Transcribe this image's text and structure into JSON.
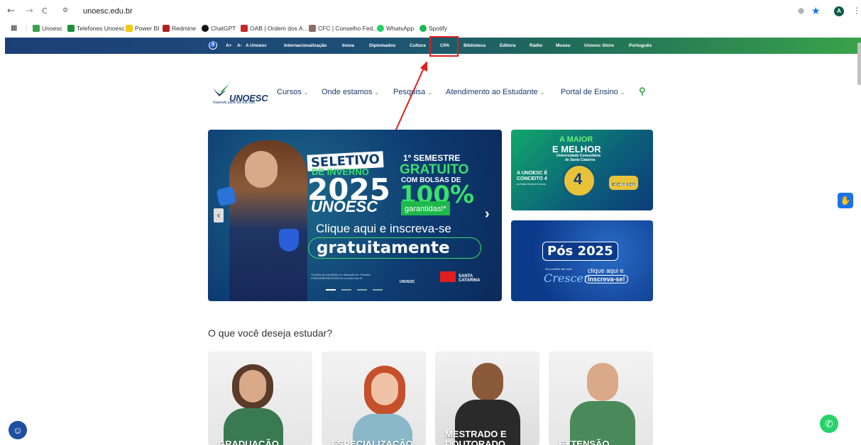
{
  "browser": {
    "url": "unoesc.edu.br",
    "back": "←",
    "forward": "→",
    "reload": "C",
    "avatar": "A",
    "bookmarks": [
      "Unoesc",
      "Telefones Unoesc",
      "Power BI",
      "Redmine",
      "ChatGPT",
      "OAB | Ordem dos A...",
      "CFC | Conselho Fed...",
      "WhatsApp",
      "Spotify"
    ]
  },
  "topbar": {
    "items": [
      "A+",
      "A-",
      "A Unoesc",
      "Internacionalização",
      "Inova",
      "Diplomados",
      "Cultura",
      "CPA",
      "Biblioteca",
      "Editora",
      "Rádio",
      "Museu",
      "Unoesc Store",
      "Português"
    ]
  },
  "header": {
    "logo": "UNOESC",
    "tagline": "Fazendo parte da sua vida",
    "menu": [
      "Cursos",
      "Onde estamos",
      "Pesquisa",
      "Atendimento ao Estudante",
      "Portal de Ensino"
    ]
  },
  "hero": {
    "line1": "SELETIVO",
    "line2": "DE INVERNO",
    "year": "2025",
    "brand": "UNOESC",
    "sem": "1º SEMESTRE",
    "gratuito": "GRATUITO",
    "bolsas": "COM BOLSAS DE",
    "pct": "100%",
    "garantidas": "garantidas!*",
    "cta1": "Clique aqui e inscreva-se",
    "cta2": "gratuitamente",
    "note": "*Confira as condições no Instrução de Trabalho nº004/DIREXEC/2025 em unoesc.edu.br",
    "logos": [
      "UNOESC",
      "SANTA CATARINA"
    ]
  },
  "side1": {
    "t1": "A MAIOR",
    "t2": "E MELHOR",
    "t3": "Universidade Comunitária",
    "t4": "de Santa Catarina",
    "t5": "A UNOESC É",
    "t6": "CONCEITO 4",
    "t7": "no Índice Geral de Cursos",
    "badge": "4",
    "btn": "CLIQUE AQUI",
    "btn2": "e saiba mais"
  },
  "side2": {
    "title": "Pós 2025",
    "sub1": "Só a melhor faz você",
    "crescer": "Crescer",
    "cta1": "clique aqui e",
    "cta2": "inscreva-se!"
  },
  "section": {
    "title": "O que você deseja estudar?"
  },
  "cards": [
    {
      "label": "GRADUAÇÃO"
    },
    {
      "label": "ESPECIALIZAÇÃO"
    },
    {
      "label": "MESTRADO E DOUTORADO"
    },
    {
      "label": "EXTENSÃO"
    }
  ],
  "colors": {
    "brand_blue": "#1b3a6b",
    "brand_green": "#3aa34a",
    "highlight_red": "#e01e1e",
    "whatsapp": "#25d366"
  }
}
